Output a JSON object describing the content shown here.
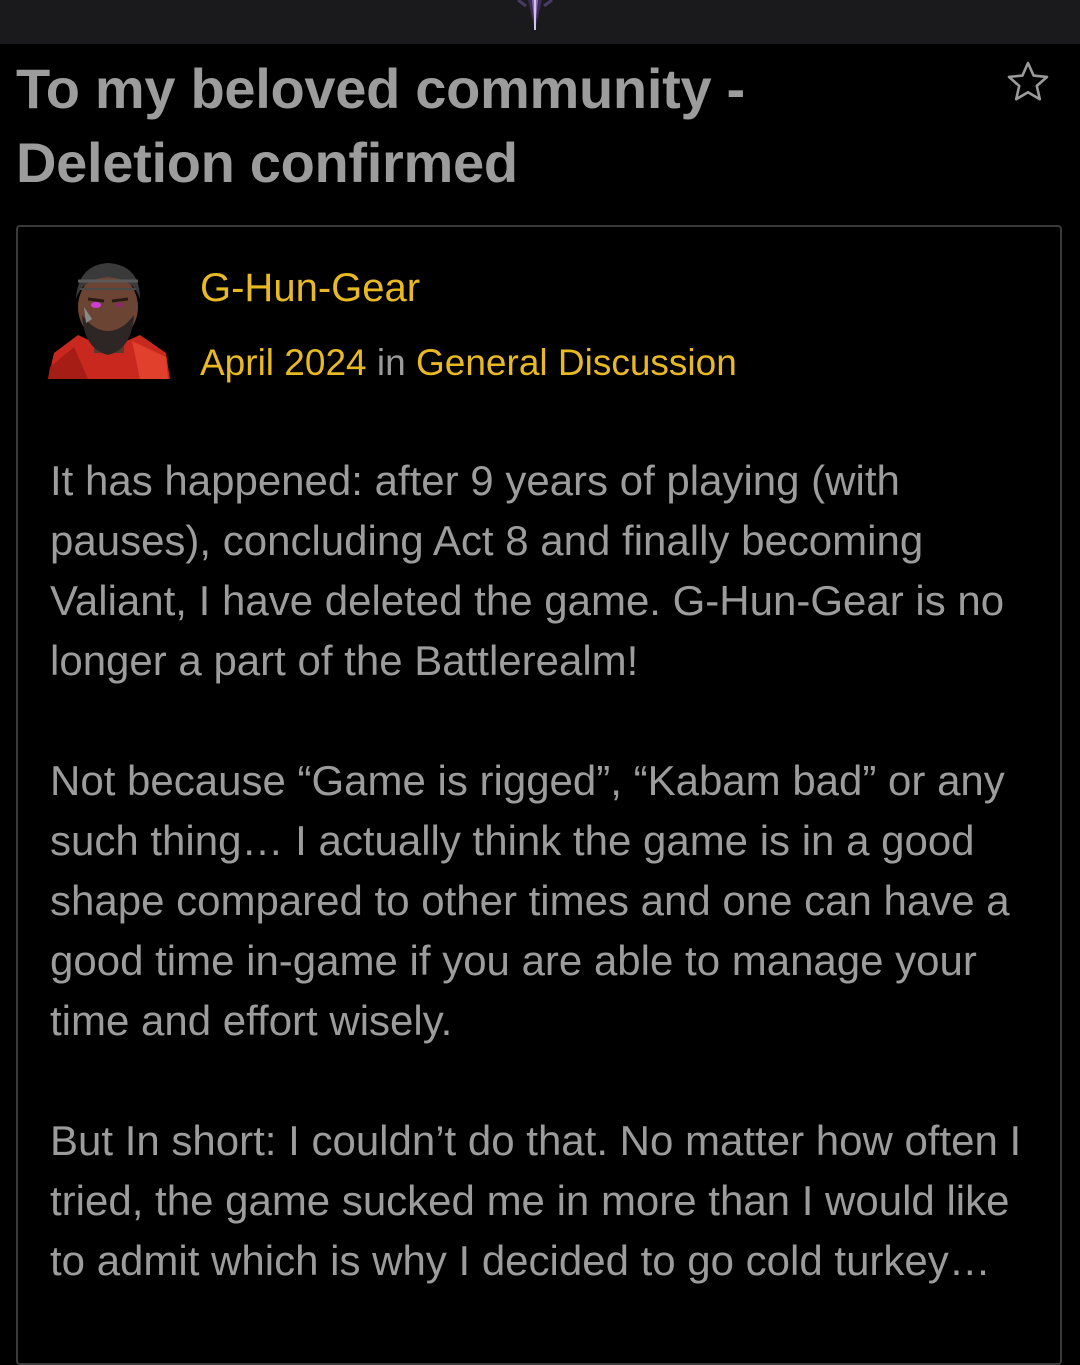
{
  "post": {
    "title": "To my beloved community - Deletion confirmed",
    "author": "G-Hun-Gear",
    "date": "April 2024",
    "in_word": "in",
    "category": "General Discussion",
    "paragraphs": [
      "It has happened: after 9 years of playing (with pauses), concluding Act 8 and finally becoming Valiant, I have deleted the game. G-Hun-Gear is no longer a part of the Battlerealm!",
      "Not because “Game is rigged”, “Kabam bad” or any such thing… I actually think the game is in a good shape compared to other times and one can have a good time in-game if you are able to manage your time and effort wisely.",
      "But In short: I couldn’t do that. No matter how often I tried, the game sucked me in more than I would like to admit which is why I decided to go cold turkey…"
    ]
  },
  "icons": {
    "favorite": "star-outline-icon",
    "site_logo": "site-logo-icon"
  },
  "colors": {
    "accent": "#e8b923",
    "text": "#9c9c9c",
    "background": "#000000",
    "border": "#3a3a3a"
  }
}
